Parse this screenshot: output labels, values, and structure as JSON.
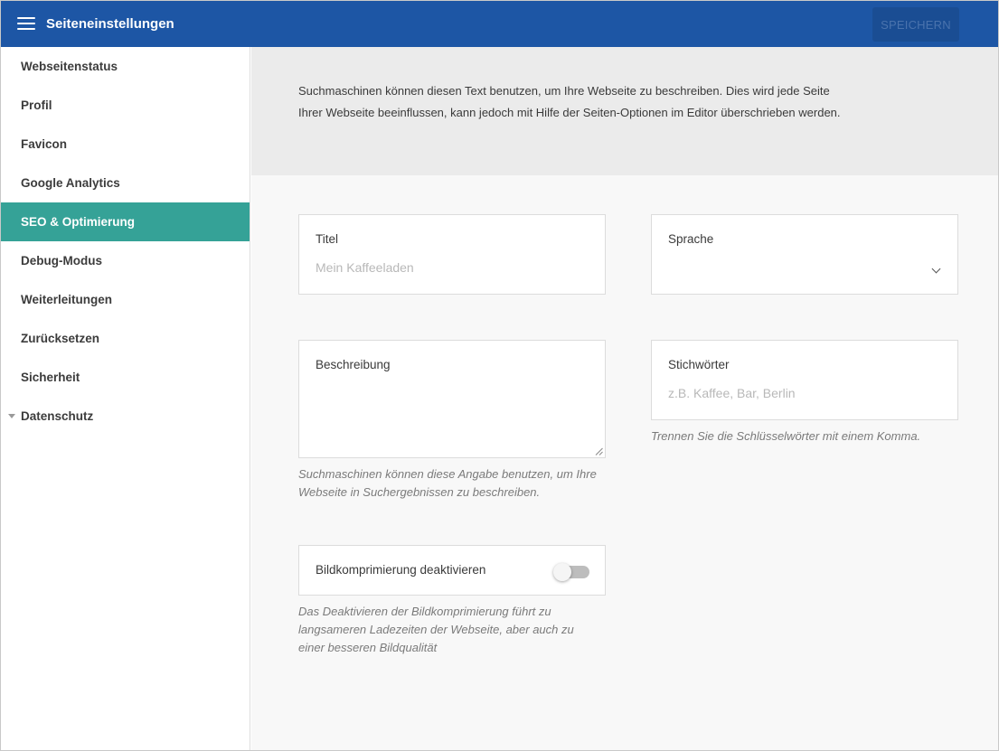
{
  "header": {
    "title": "Seiteneinstellungen",
    "save_label": "SPEICHERN"
  },
  "sidebar": {
    "items": [
      {
        "label": "Webseitenstatus"
      },
      {
        "label": "Profil"
      },
      {
        "label": "Favicon"
      },
      {
        "label": "Google Analytics"
      },
      {
        "label": "SEO & Optimierung",
        "active": true
      },
      {
        "label": "Debug-Modus"
      },
      {
        "label": "Weiterleitungen"
      },
      {
        "label": "Zurücksetzen"
      },
      {
        "label": "Sicherheit"
      },
      {
        "label": "Datenschutz",
        "expandable": true
      }
    ]
  },
  "main": {
    "intro": "Suchmaschinen können diesen Text benutzen, um Ihre Webseite zu beschreiben. Dies wird jede Seite Ihrer Webseite beeinflussen, kann jedoch mit Hilfe der Seiten-Optionen im Editor überschrieben werden.",
    "title_field": {
      "label": "Titel",
      "placeholder": "Mein Kaffeeladen",
      "value": ""
    },
    "language_field": {
      "label": "Sprache",
      "value": ""
    },
    "description_field": {
      "label": "Beschreibung",
      "value": "",
      "hint": "Suchmaschinen können diese Angabe benutzen, um Ihre Webseite in Suchergebnissen zu beschreiben."
    },
    "keywords_field": {
      "label": "Stichwörter",
      "placeholder": "z.B. Kaffee, Bar, Berlin",
      "value": "",
      "hint": "Trennen Sie die Schlüsselwörter mit einem Komma."
    },
    "compression": {
      "label": "Bildkomprimierung deaktivieren",
      "enabled": false,
      "hint": "Das Deaktivieren der Bildkomprimierung führt zu langsameren Ladezeiten der Webseite, aber auch zu einer besseren Bildqualität"
    }
  },
  "colors": {
    "header": "#1d56a5",
    "active_item": "#35a297",
    "intro_bg": "#ebebeb",
    "content_bg": "#f8f8f8"
  }
}
